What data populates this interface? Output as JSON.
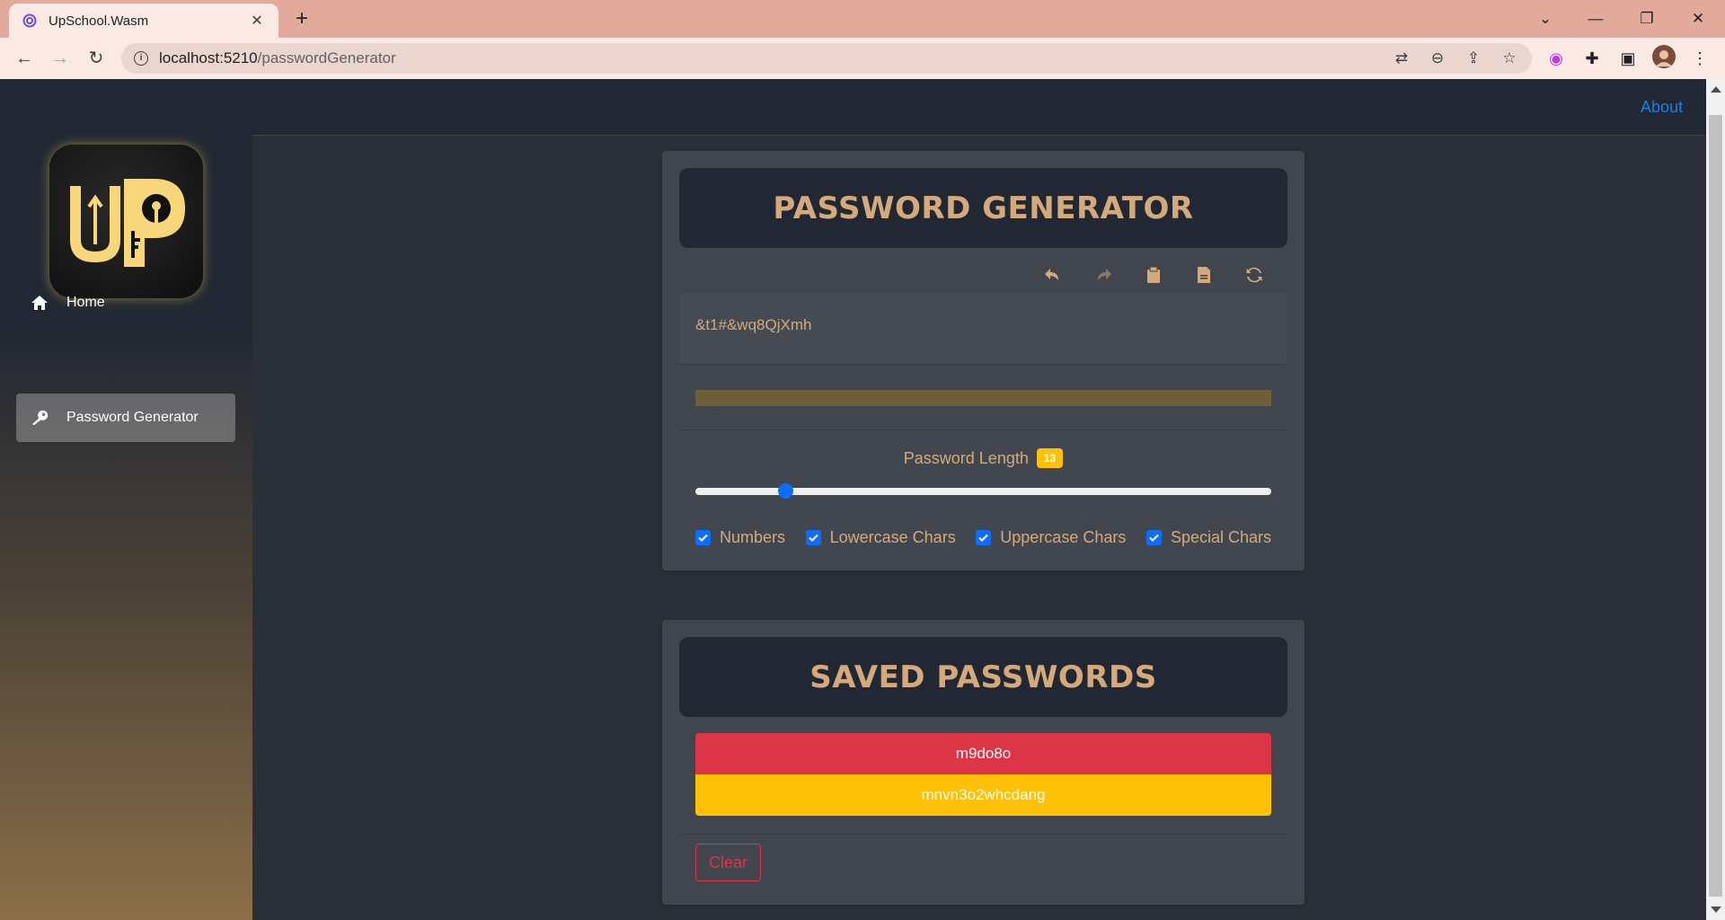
{
  "browser": {
    "tab_title": "UpSchool.Wasm",
    "url_host": "localhost:5210",
    "url_path": "/passwordGenerator"
  },
  "sidebar": {
    "logo_icon": "upschool-logo",
    "items": [
      {
        "label": "Home",
        "icon": "home-icon",
        "active": false
      },
      {
        "label": "Password Generator",
        "icon": "key-icon",
        "active": true
      }
    ]
  },
  "topbar": {
    "about_label": "About"
  },
  "generator": {
    "title": "PASSWORD GENERATOR",
    "actions": [
      "undo-icon",
      "redo-icon",
      "clipboard-icon",
      "save-file-icon",
      "refresh-icon"
    ],
    "password": "&t1#&wq8QjXmh",
    "strength_color": "#6e5f38",
    "length_label": "Password Length",
    "length_value": "13",
    "length_min": 8,
    "length_max": 40,
    "options": [
      {
        "label": "Numbers",
        "checked": true
      },
      {
        "label": "Lowercase Chars",
        "checked": true
      },
      {
        "label": "Uppercase Chars",
        "checked": true
      },
      {
        "label": "Special Chars",
        "checked": true
      }
    ]
  },
  "saved": {
    "title": "SAVED PASSWORDS",
    "items": [
      {
        "value": "m9do8o",
        "color": "#dc3545"
      },
      {
        "value": "mnvn3o2whcdang",
        "color": "#ffc107"
      }
    ],
    "clear_label": "Clear"
  },
  "colors": {
    "accent": "#d4aa7d",
    "primary": "#0d6efd",
    "danger": "#dc3545",
    "warning": "#ffc107",
    "link": "#1a7ee8"
  }
}
